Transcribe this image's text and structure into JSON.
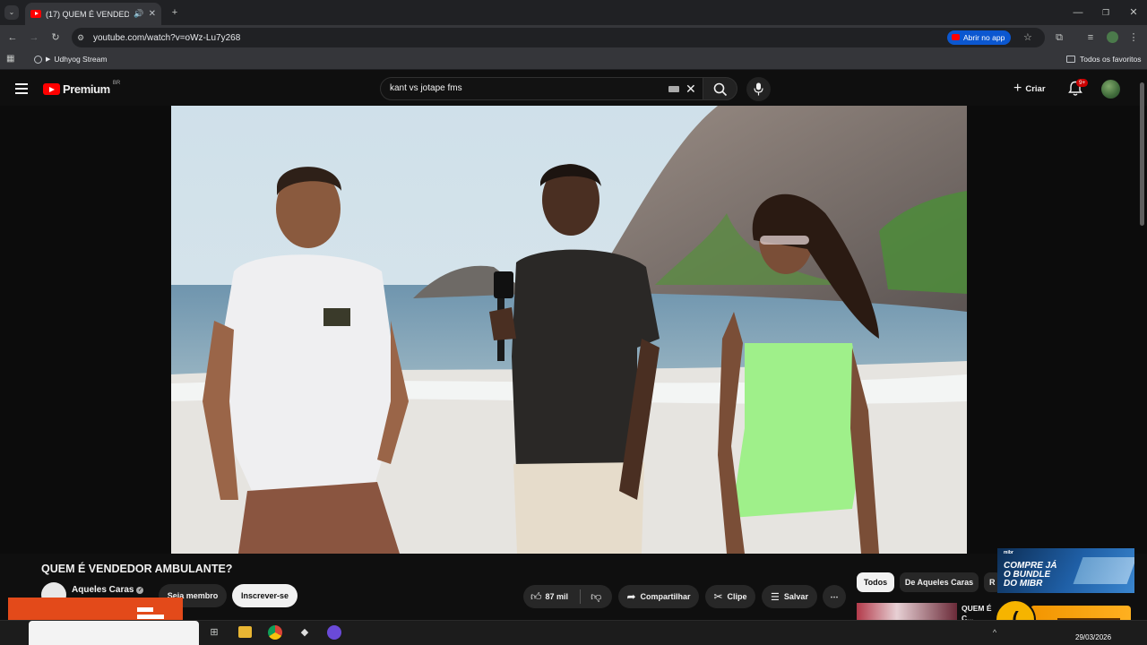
{
  "browser": {
    "tab_title": "(17) QUEM É VENDEDOR AI",
    "url": "youtube.com/watch?v=oWz-Lu7y268",
    "open_in_app": "Abrir no app",
    "bookmark_item": "Udhyog Stream",
    "all_bookmarks": "Todos os favoritos"
  },
  "youtube": {
    "logo_text": "Premium",
    "region": "BR",
    "search_value": "kant vs jotape fms",
    "create_label": "Criar",
    "notif_badge": "9+"
  },
  "video": {
    "title": "QUEM É VENDEDOR AMBULANTE?",
    "channel": "Aqueles Caras",
    "member_label": "Seja membro",
    "subscribe_label": "Inscrever-se",
    "likes": "87 mil",
    "share_label": "Compartilhar",
    "clip_label": "Clipe",
    "save_label": "Salvar"
  },
  "chips": [
    "Todos",
    "De Aqueles Caras",
    "R"
  ],
  "recommendation": {
    "title_partial": "QUEM É C... DIVORC..."
  },
  "ad": {
    "line1": "COMPRE JÁ",
    "line2": "O BUNDLE",
    "line3": "DO MIBR",
    "brand": "mibr"
  },
  "taskbar": {
    "date": "29/03/2026"
  },
  "colors": {
    "accent_red": "#ff0000",
    "orange_overlay": "#e34a1a",
    "ad_blue": "#1f5fa6"
  }
}
